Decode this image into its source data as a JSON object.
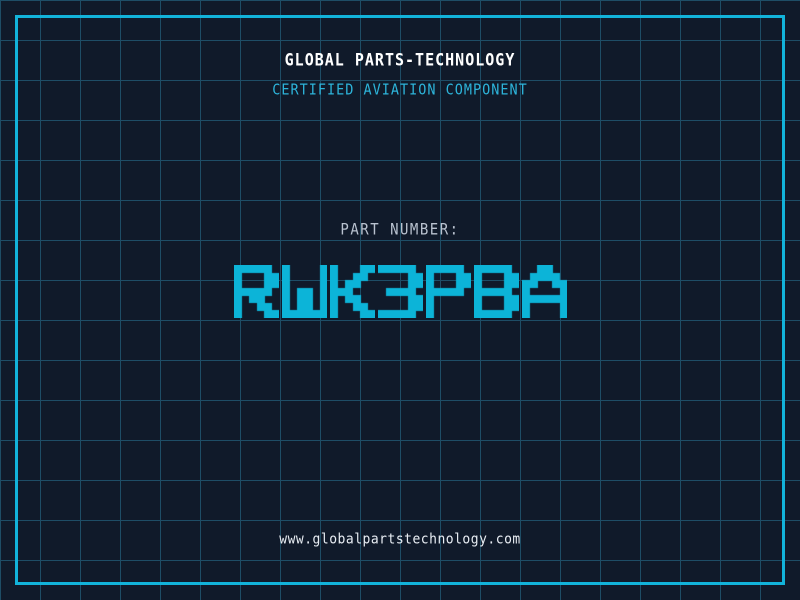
{
  "header": {
    "title": "GLOBAL PARTS-TECHNOLOGY",
    "subtitle": "CERTIFIED AVIATION COMPONENT"
  },
  "part": {
    "label": "PART NUMBER:",
    "value": "RWK3PBA"
  },
  "footer": {
    "url": "www.globalpartstechnology.com"
  },
  "colors": {
    "background": "#101a2a",
    "grid_line": "#1e4d66",
    "frame": "#12b3da",
    "title": "#ffffff",
    "subtitle": "#2db4da",
    "part_label": "#b9c2cf",
    "part_number": "#0cb4d8",
    "url": "#e8edf3"
  }
}
